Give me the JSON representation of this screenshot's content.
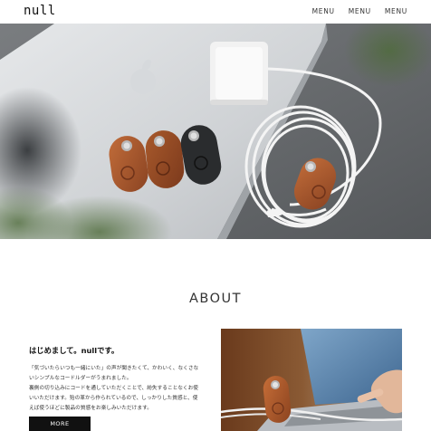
{
  "header": {
    "logo": "null",
    "nav": [
      "MENU",
      "MENU",
      "MENU"
    ]
  },
  "about": {
    "title": "ABOUT",
    "heading": "はじめまして。nullです。",
    "body_lines": [
      "「気づいたらいつも一緒にいた」の声が聞きたくて、かわいく、なくさな",
      "いシンプルなコードルダーがうまれました。",
      "裏側の切り込みにコードを通していただくことで、紛失することなくお使",
      "いいただけます。殆の革から作られているので、しっかりした質感と、使",
      "えば使うほどに製品の質感をお楽しみいただけます。"
    ],
    "button": "MORE"
  },
  "colors": {
    "text": "#222222",
    "button_bg": "#111111",
    "button_text": "#ffffff",
    "leather_brown": "#a45a2f",
    "leather_black": "#2a2c2e"
  },
  "icons": {
    "hero": "photo-laptop-charger-cable-holders",
    "about": "photo-hand-laptop-cable-holder"
  }
}
